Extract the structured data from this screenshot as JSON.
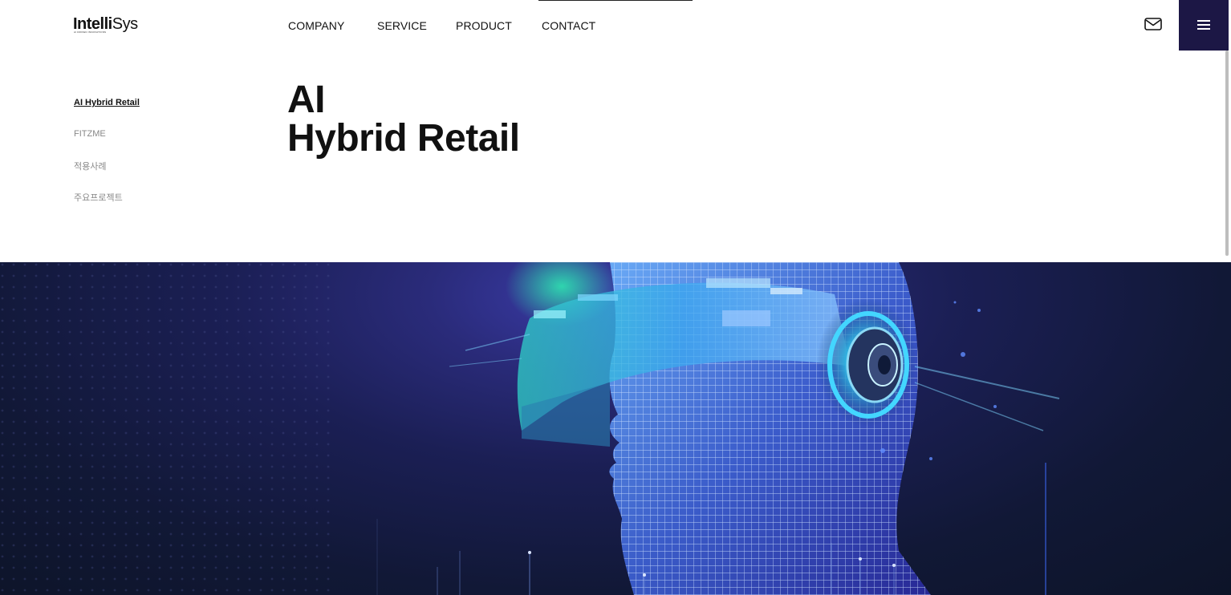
{
  "brand": {
    "name_bold": "Intelli",
    "name_light": "Sys",
    "tagline": "AI DRIVEN INNOVATIONS"
  },
  "nav": {
    "items": [
      {
        "label": "COMPANY"
      },
      {
        "label": "SERVICE"
      },
      {
        "label": "PRODUCT"
      },
      {
        "label": "CONTACT"
      }
    ]
  },
  "header_icons": {
    "mail": "mail-icon",
    "menu": "hamburger-menu-icon"
  },
  "sidebar": {
    "items": [
      {
        "label": "AI Hybrid Retail",
        "active": true
      },
      {
        "label": "FITZME",
        "active": false
      },
      {
        "label": "적용사례",
        "active": false
      },
      {
        "label": "주요프로젝트",
        "active": false
      }
    ]
  },
  "page": {
    "title_line1": "AI",
    "title_line2": "Hybrid Retail"
  },
  "colors": {
    "menu_bg": "#1c1745",
    "hero_dark": "#111836",
    "hero_glow": "#3a3ba8",
    "accent_cyan": "#3fc6e8"
  }
}
